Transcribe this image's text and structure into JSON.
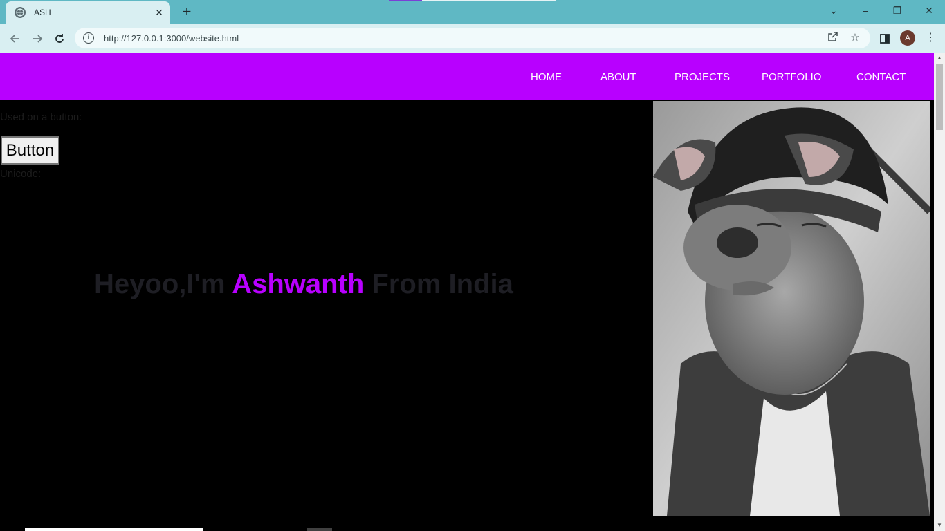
{
  "browser": {
    "tab_title": "ASH",
    "tab_close": "✕",
    "new_tab": "+",
    "url": "http://127.0.0.1:3000/website.html",
    "profile_initial": "A",
    "window_controls": {
      "dropdown": "⌄",
      "minimize": "–",
      "restore": "❐",
      "close": "✕"
    },
    "icons": {
      "back": "arrow-left-icon",
      "forward": "arrow-right-icon",
      "reload": "reload-icon",
      "info": "info-icon",
      "share": "share-icon",
      "bookmark": "star-icon",
      "sidepanel": "side-panel-icon",
      "menu": "kebab-menu-icon"
    }
  },
  "nav": {
    "items": [
      {
        "label": "HOME"
      },
      {
        "label": "ABOUT"
      },
      {
        "label": "PROJECTS"
      },
      {
        "label": "PORTFOLIO"
      },
      {
        "label": "CONTACT"
      }
    ]
  },
  "content": {
    "used_on_button": "Used on a button:",
    "button_label": "Button",
    "unicode_label": "Unicode:",
    "hero": {
      "prefix": "Heyoo,I'm ",
      "name": "Ashwanth",
      "suffix": " From India"
    }
  },
  "colors": {
    "accent": "#b800ff",
    "page_bg": "#000000",
    "hero_text": "#1e1e24",
    "chrome_tab_bar": "#5fb8c4",
    "chrome_toolbar": "#d9eff2"
  }
}
